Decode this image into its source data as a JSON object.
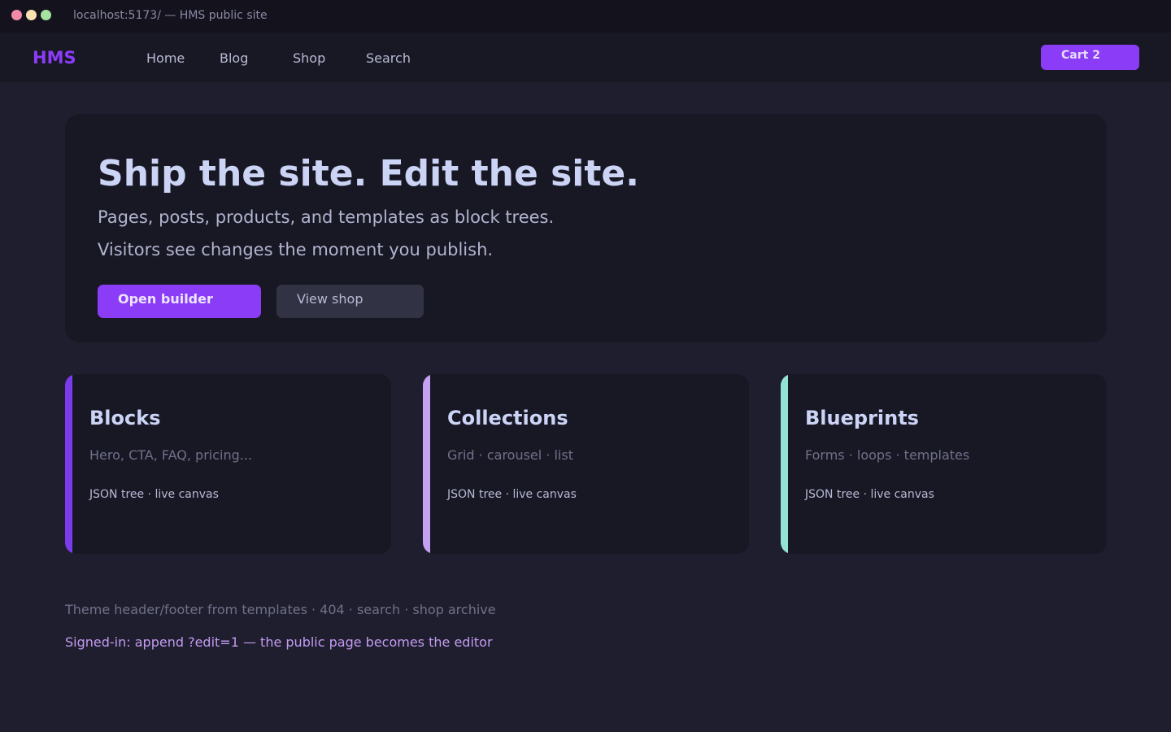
{
  "window": {
    "title": "localhost:5173/ — HMS public site"
  },
  "navbar": {
    "logo": "HMS",
    "links": [
      "Home",
      "Blog",
      "Shop",
      "Search"
    ],
    "cart_label": "Cart 2"
  },
  "hero": {
    "title": "Ship the site. Edit the site.",
    "lines": [
      "Pages, posts, products, and templates as block trees.",
      "Visitors see changes the moment you publish."
    ],
    "primary_button": "Open builder",
    "secondary_button": "View shop"
  },
  "cards": [
    {
      "title": "Blocks",
      "subtitle": "Hero, CTA, FAQ, pricing...",
      "meta": "JSON tree · live canvas",
      "accent": "#7c3aed"
    },
    {
      "title": "Collections",
      "subtitle": "Grid · carousel · list",
      "meta": "JSON tree · live canvas",
      "accent": "#c4a1f2"
    },
    {
      "title": "Blueprints",
      "subtitle": "Forms · loops · templates",
      "meta": "JSON tree · live canvas",
      "accent": "#94e2d5"
    }
  ],
  "footer": {
    "note": "Theme header/footer from templates · 404 · search · shop archive",
    "hint": "Signed-in: append ?edit=1 — the public page becomes the editor"
  },
  "colors": {
    "background": "#1f1e2e",
    "panel": "#181825",
    "accent": "#8b3cf7",
    "text": "#ccd4f6"
  }
}
